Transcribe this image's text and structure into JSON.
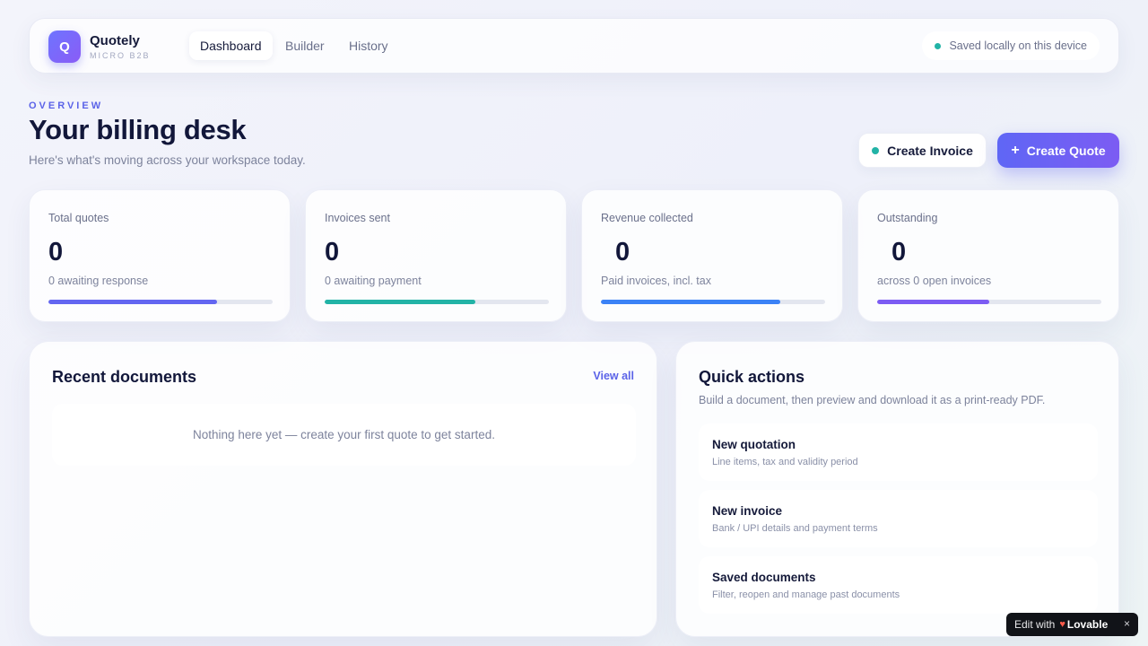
{
  "header": {
    "logo_letter": "Q",
    "brand_name": "Quotely",
    "brand_sub": "MICRO B2B",
    "tabs": [
      {
        "label": "Dashboard",
        "active": true
      },
      {
        "label": "Builder",
        "active": false
      },
      {
        "label": "History",
        "active": false
      }
    ],
    "saved_status": "Saved locally on this device"
  },
  "hero": {
    "eyebrow": "OVERVIEW",
    "title": "Your billing desk",
    "subtitle": "Here's what's moving across your workspace today.",
    "create_invoice_label": "Create Invoice",
    "create_quote_label": "Create Quote"
  },
  "stats": [
    {
      "label": "Total quotes",
      "value": "0",
      "note": "0 awaiting response",
      "progress": 0.75,
      "color": "#6366f1"
    },
    {
      "label": "Invoices sent",
      "value": "0",
      "note": "0 awaiting payment",
      "progress": 0.67,
      "color": "#22b3a6"
    },
    {
      "label": "Revenue collected",
      "value": "0",
      "note": "Paid invoices, incl. tax",
      "progress": 0.8,
      "color": "#3b82f6"
    },
    {
      "label": "Outstanding",
      "value": "0",
      "note": "across 0 open invoices",
      "progress": 0.5,
      "color": "#7c5cf3"
    }
  ],
  "recent": {
    "title": "Recent documents",
    "view_all": "View all",
    "empty_text": "Nothing here yet — create your first quote to get started."
  },
  "quick_actions": {
    "title": "Quick actions",
    "subtitle": "Build a document, then preview and download it as a print-ready PDF.",
    "items": [
      {
        "title": "New quotation",
        "desc": "Line items, tax and validity period"
      },
      {
        "title": "New invoice",
        "desc": "Bank / UPI details and payment terms"
      },
      {
        "title": "Saved documents",
        "desc": "Filter, reopen and manage past documents"
      }
    ]
  },
  "badge": {
    "edit_with": "Edit with",
    "brand": "Lovable",
    "close": "×"
  },
  "colors": {
    "accent": "#5b63e8",
    "teal": "#22b3a6",
    "ink": "#12173a"
  }
}
